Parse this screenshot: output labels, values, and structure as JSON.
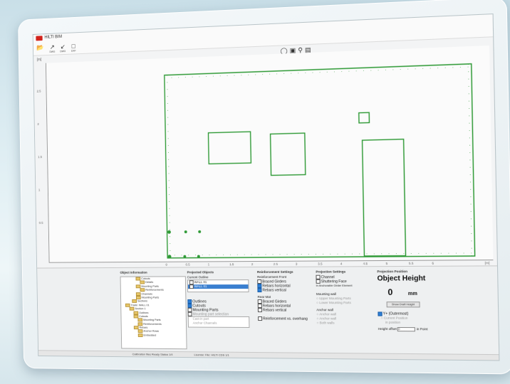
{
  "app": {
    "title": "HILTI BIM"
  },
  "toolbar": {
    "items": [
      {
        "icon": "open-folder-icon",
        "label": ""
      },
      {
        "icon": "export-icon",
        "label": "DWG"
      },
      {
        "icon": "import-icon",
        "label": "DWG"
      },
      {
        "icon": "export-dxf-icon",
        "label": "DXF"
      }
    ]
  },
  "plot": {
    "y_unit": "[m]",
    "y_ticks": [
      "2.5",
      "2",
      "1.5",
      "1",
      "0.5"
    ],
    "x_ticks": [
      "0",
      "0.5",
      "1",
      "1.5",
      "2",
      "2.5",
      "3",
      "3.5",
      "4",
      "4.5",
      "5",
      "5.5",
      "6"
    ],
    "x_end": "[m]",
    "line_color": "#2f9a36"
  },
  "panel": {
    "object_information": {
      "title": "Object Information",
      "tree": [
        "Cutouts",
        "Details",
        "Mounting Parts",
        "Reinforcements",
        "Channels",
        "Mounting Parts",
        "Sections",
        "Trade: WALL 01",
        "Section 1",
        "Outlines",
        "Cutouts",
        "Mounting Parts",
        "Reinforcements",
        "Rebars",
        "Anchor Rows",
        "Embedded"
      ]
    },
    "projected_objects": {
      "title": "Projected Objects",
      "current_outline_label": "Current Outline",
      "outline_items": [
        "WALL 01",
        "WALL 01"
      ],
      "checks": [
        {
          "label": "Outlines",
          "checked": true
        },
        {
          "label": "Cutouts",
          "checked": true
        },
        {
          "label": "Mounting Parts",
          "checked": false
        }
      ],
      "mounting_part_selection": "Mounting part selection",
      "mp_items": [
        "Cast-in part",
        "Anchor Channels"
      ]
    },
    "reinforcement": {
      "title": "Reinforcement Settings",
      "front_title": "Reinforcement Front",
      "front": [
        {
          "label": "Braced Girders",
          "checked": false
        },
        {
          "label": "Rebars horizontal",
          "checked": true
        },
        {
          "label": "Rebars vertical",
          "checked": true
        }
      ],
      "rear_title": "Rear Mat",
      "rear": [
        {
          "label": "Braced Girders",
          "checked": false
        },
        {
          "label": "Rebars horizontal",
          "checked": false
        },
        {
          "label": "Rebars vertical",
          "checked": false
        }
      ],
      "bottom": "Reinforcement vs. overhang"
    },
    "projection": {
      "title": "Projection Settings",
      "checks": [
        {
          "label": "Channel",
          "checked": false
        },
        {
          "label": "Shuttering Face",
          "checked": false
        }
      ],
      "note": "In Anchorable Girder Element",
      "mounting_title": "Mounting wall",
      "mounting": [
        "Upper Mounting Parts",
        "Lower Mounting Parts"
      ],
      "anchor_title": "Anchor wall",
      "anchor": [
        "Anchor wall",
        "Anchor wall",
        "Both walls"
      ]
    },
    "projection_position": {
      "title": "Projection Position",
      "heading": "Object Height",
      "value": "0",
      "unit": "mm",
      "button": "Show Draft Height",
      "y_label": "Y+ (Outermost)",
      "sub_label": "Current Position",
      "sub_label2": "in position",
      "offset_label": "Height offset",
      "offset_value": "0",
      "offset_unit": "in Point"
    }
  },
  "status": {
    "left": "Calibration files Ready Status 1/4",
    "mid": "License: File: HILTI CDS 1/1"
  }
}
